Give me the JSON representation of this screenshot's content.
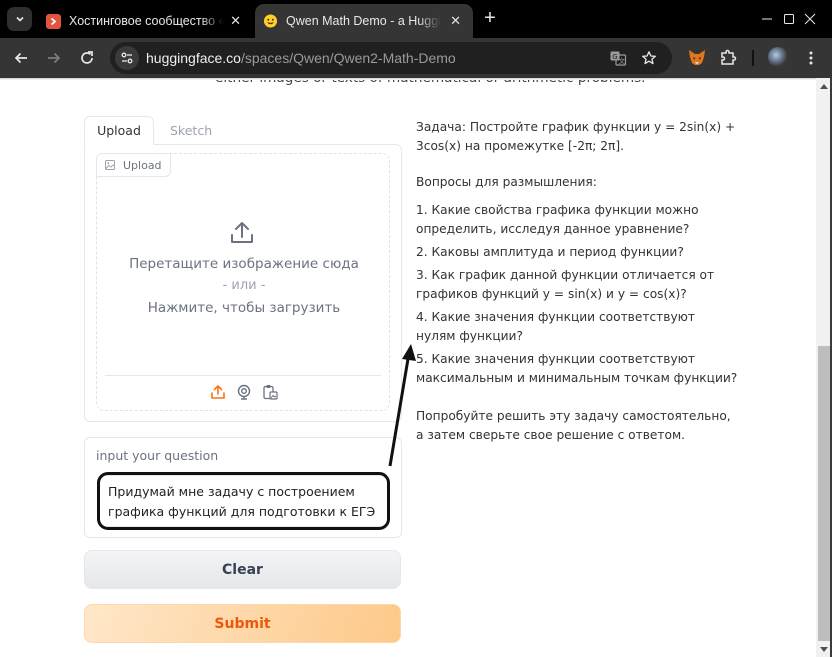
{
  "browser": {
    "tabs": [
      {
        "title": "Хостинговое сообщество «Timeweb",
        "favicon": "timeweb-icon",
        "favicon_color": "#e2543b",
        "active": false
      },
      {
        "title": "Qwen Math Demo - a Hugging Face Space",
        "favicon": "hugging-face-icon",
        "favicon_color": "#ffcf28",
        "active": true
      }
    ],
    "url_host": "huggingface.co",
    "url_path": "/spaces/Qwen/Qwen2-Math-Demo",
    "icons": {
      "tab_search": "chevron-down-icon",
      "new_tab": "+",
      "back": "back-arrow-icon",
      "forward": "forward-arrow-icon",
      "reload": "reload-icon",
      "site_info": "tune-icon",
      "translate": "translate-icon",
      "bookmark": "star-icon",
      "metamask": "metamask-fox-icon",
      "extensions": "puzzle-icon",
      "profile": "avatar",
      "menu": "kebab-menu-icon"
    }
  },
  "page": {
    "subtitle": "either images or texts of mathematical or arithmetic problems.",
    "image_input": {
      "tabs": [
        "Upload",
        "Sketch"
      ],
      "selected_tab": "Upload",
      "label": "Upload",
      "drop_text": "Перетащите изображение сюда",
      "or_text": "- или -",
      "click_text": "Нажмите, чтобы загрузить",
      "sources": [
        "upload",
        "webcam",
        "clipboard"
      ],
      "active_source_color": "#f97316"
    },
    "question": {
      "label": "input your question",
      "value": "Придумай мне задачу с построением графика функций для подготовки к ЕГЭ"
    },
    "buttons": {
      "clear": "Clear",
      "submit": "Submit"
    },
    "output": {
      "task": "Задача: Постройте график функции y = 2sin(x) + 3cos(x) на промежутке [-2π; 2π].",
      "questions_heading": "Вопросы для размышления:",
      "questions": [
        "1. Какие свойства графика функции можно определить, исследуя данное уравнение?",
        "2. Каковы амплитуда и период функции?",
        "3. Как график данной функции отличается от графиков функций y = sin(x) и y = cos(x)?",
        "4. Какие значения функции соответствуют нулям функции?",
        "5. Какие значения функции соответствуют максимальным и минимальным точкам функции?"
      ],
      "closing": "Попробуйте решить эту задачу самостоятельно, а затем сверьте свое решение с ответом."
    }
  },
  "scroll": {
    "position_fraction": 0.52,
    "visible_fraction": 0.54
  }
}
